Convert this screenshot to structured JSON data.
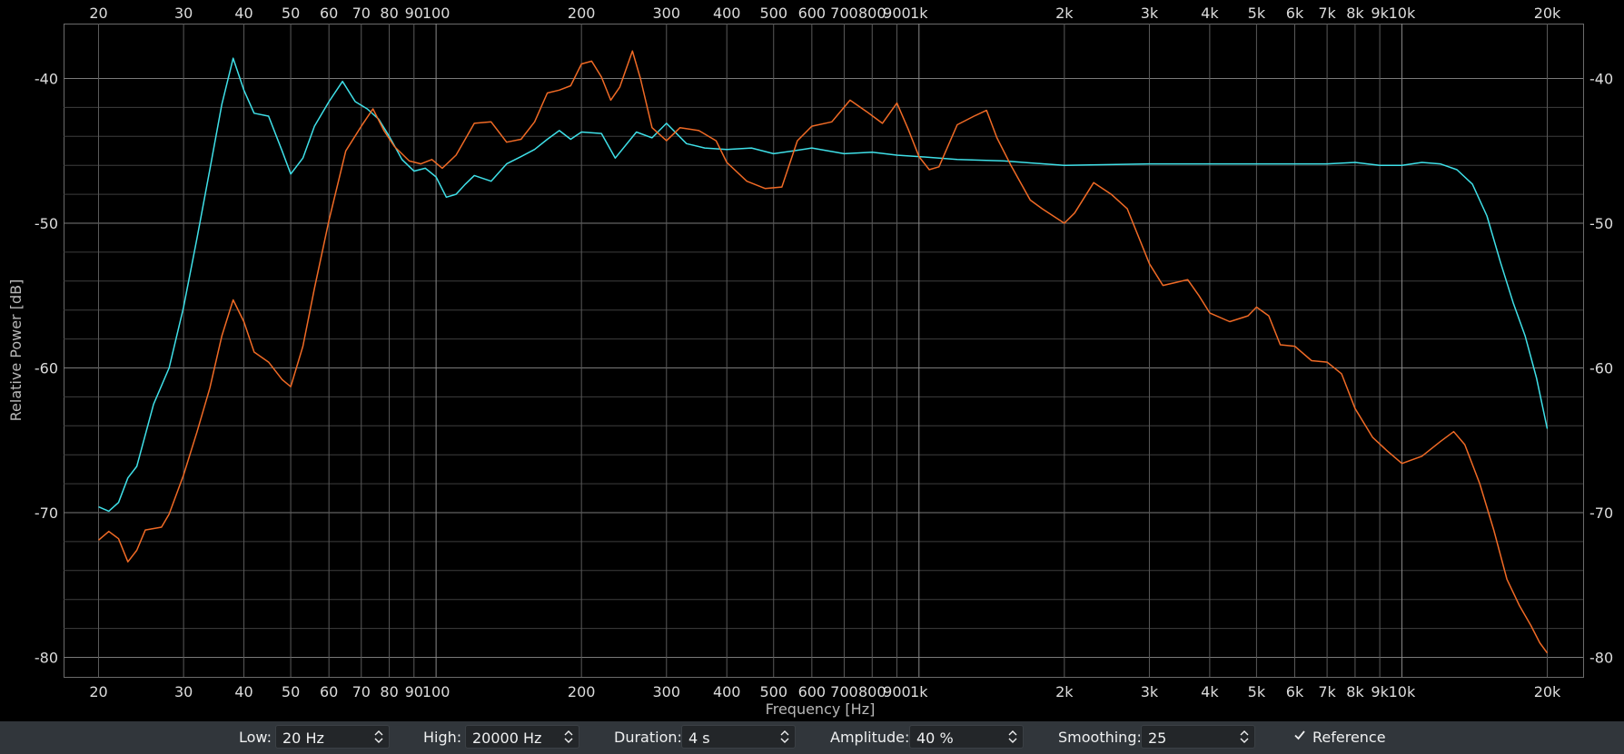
{
  "chart_data": {
    "type": "line",
    "xlabel": "Frequency [Hz]",
    "ylabel": "Relative Power [dB]",
    "x_scale": "log",
    "xlim": [
      20,
      20000
    ],
    "ylim": [
      -80,
      -40
    ],
    "grid": true,
    "x_ticks": [
      {
        "v": 20,
        "label": "20"
      },
      {
        "v": 30,
        "label": "30"
      },
      {
        "v": 40,
        "label": "40"
      },
      {
        "v": 50,
        "label": "50"
      },
      {
        "v": 60,
        "label": "60"
      },
      {
        "v": 70,
        "label": "70"
      },
      {
        "v": 80,
        "label": "80"
      },
      {
        "v": 90,
        "label": "90"
      },
      {
        "v": 100,
        "label": "100"
      },
      {
        "v": 200,
        "label": "200"
      },
      {
        "v": 300,
        "label": "300"
      },
      {
        "v": 400,
        "label": "400"
      },
      {
        "v": 500,
        "label": "500"
      },
      {
        "v": 600,
        "label": "600"
      },
      {
        "v": 700,
        "label": "700"
      },
      {
        "v": 800,
        "label": "800"
      },
      {
        "v": 900,
        "label": "900"
      },
      {
        "v": 1000,
        "label": "1k"
      },
      {
        "v": 2000,
        "label": "2k"
      },
      {
        "v": 3000,
        "label": "3k"
      },
      {
        "v": 4000,
        "label": "4k"
      },
      {
        "v": 5000,
        "label": "5k"
      },
      {
        "v": 6000,
        "label": "6k"
      },
      {
        "v": 7000,
        "label": "7k"
      },
      {
        "v": 8000,
        "label": "8k"
      },
      {
        "v": 9000,
        "label": "9k"
      },
      {
        "v": 10000,
        "label": "10k"
      },
      {
        "v": 20000,
        "label": "20k"
      }
    ],
    "y_ticks": [
      {
        "v": -40,
        "label": "-40"
      },
      {
        "v": -50,
        "label": "-50"
      },
      {
        "v": -60,
        "label": "-60"
      },
      {
        "v": -70,
        "label": "-70"
      },
      {
        "v": -80,
        "label": "-80"
      }
    ],
    "series": [
      {
        "color": "#3fe0e8",
        "points": [
          [
            20,
            -69.6
          ],
          [
            21,
            -69.9
          ],
          [
            22,
            -69.3
          ],
          [
            23,
            -67.6
          ],
          [
            24,
            -66.8
          ],
          [
            26,
            -62.5
          ],
          [
            28,
            -60.0
          ],
          [
            30,
            -55.8
          ],
          [
            32,
            -51.0
          ],
          [
            34,
            -46.3
          ],
          [
            36,
            -41.8
          ],
          [
            38,
            -38.6
          ],
          [
            40,
            -40.8
          ],
          [
            42,
            -42.4
          ],
          [
            45,
            -42.6
          ],
          [
            48,
            -45.0
          ],
          [
            50,
            -46.6
          ],
          [
            53,
            -45.5
          ],
          [
            56,
            -43.3
          ],
          [
            60,
            -41.6
          ],
          [
            64,
            -40.2
          ],
          [
            68,
            -41.6
          ],
          [
            72,
            -42.1
          ],
          [
            76,
            -42.8
          ],
          [
            80,
            -44.0
          ],
          [
            85,
            -45.6
          ],
          [
            90,
            -46.4
          ],
          [
            95,
            -46.2
          ],
          [
            100,
            -46.8
          ],
          [
            105,
            -48.2
          ],
          [
            110,
            -48.0
          ],
          [
            115,
            -47.3
          ],
          [
            120,
            -46.7
          ],
          [
            130,
            -47.1
          ],
          [
            140,
            -45.9
          ],
          [
            150,
            -45.4
          ],
          [
            160,
            -44.9
          ],
          [
            170,
            -44.2
          ],
          [
            180,
            -43.6
          ],
          [
            190,
            -44.2
          ],
          [
            200,
            -43.7
          ],
          [
            220,
            -43.8
          ],
          [
            235,
            -45.5
          ],
          [
            260,
            -43.7
          ],
          [
            280,
            -44.1
          ],
          [
            300,
            -43.1
          ],
          [
            330,
            -44.5
          ],
          [
            360,
            -44.8
          ],
          [
            400,
            -44.9
          ],
          [
            450,
            -44.8
          ],
          [
            500,
            -45.2
          ],
          [
            550,
            -45.0
          ],
          [
            600,
            -44.8
          ],
          [
            700,
            -45.2
          ],
          [
            800,
            -45.1
          ],
          [
            900,
            -45.3
          ],
          [
            1000,
            -45.4
          ],
          [
            1200,
            -45.6
          ],
          [
            1500,
            -45.7
          ],
          [
            2000,
            -46.0
          ],
          [
            3000,
            -45.9
          ],
          [
            4000,
            -45.9
          ],
          [
            5000,
            -45.9
          ],
          [
            6000,
            -45.9
          ],
          [
            7000,
            -45.9
          ],
          [
            8000,
            -45.8
          ],
          [
            9000,
            -46.0
          ],
          [
            10000,
            -46.0
          ],
          [
            11000,
            -45.8
          ],
          [
            12000,
            -45.9
          ],
          [
            13000,
            -46.3
          ],
          [
            14000,
            -47.3
          ],
          [
            15000,
            -49.5
          ],
          [
            16000,
            -52.7
          ],
          [
            17000,
            -55.5
          ],
          [
            18000,
            -57.8
          ],
          [
            19000,
            -60.7
          ],
          [
            20000,
            -64.2
          ]
        ]
      },
      {
        "color": "#f06a25",
        "points": [
          [
            20,
            -71.9
          ],
          [
            21,
            -71.3
          ],
          [
            22,
            -71.8
          ],
          [
            23,
            -73.4
          ],
          [
            24,
            -72.6
          ],
          [
            25,
            -71.2
          ],
          [
            27,
            -71.0
          ],
          [
            28,
            -70.1
          ],
          [
            30,
            -67.4
          ],
          [
            32,
            -64.4
          ],
          [
            34,
            -61.4
          ],
          [
            36,
            -57.8
          ],
          [
            38,
            -55.3
          ],
          [
            40,
            -56.8
          ],
          [
            42,
            -58.9
          ],
          [
            45,
            -59.6
          ],
          [
            48,
            -60.8
          ],
          [
            50,
            -61.3
          ],
          [
            53,
            -58.5
          ],
          [
            56,
            -54.5
          ],
          [
            60,
            -49.8
          ],
          [
            65,
            -45.0
          ],
          [
            70,
            -43.3
          ],
          [
            74,
            -42.1
          ],
          [
            78,
            -43.6
          ],
          [
            82,
            -44.7
          ],
          [
            88,
            -45.7
          ],
          [
            93,
            -45.9
          ],
          [
            98,
            -45.6
          ],
          [
            103,
            -46.2
          ],
          [
            110,
            -45.3
          ],
          [
            120,
            -43.1
          ],
          [
            130,
            -43.0
          ],
          [
            140,
            -44.4
          ],
          [
            150,
            -44.2
          ],
          [
            160,
            -43.0
          ],
          [
            170,
            -41.0
          ],
          [
            180,
            -40.8
          ],
          [
            190,
            -40.5
          ],
          [
            200,
            -39.0
          ],
          [
            210,
            -38.8
          ],
          [
            220,
            -39.9
          ],
          [
            230,
            -41.5
          ],
          [
            240,
            -40.6
          ],
          [
            255,
            -38.1
          ],
          [
            265,
            -40.0
          ],
          [
            280,
            -43.4
          ],
          [
            300,
            -44.3
          ],
          [
            320,
            -43.4
          ],
          [
            350,
            -43.6
          ],
          [
            380,
            -44.3
          ],
          [
            400,
            -45.8
          ],
          [
            440,
            -47.1
          ],
          [
            480,
            -47.6
          ],
          [
            520,
            -47.5
          ],
          [
            560,
            -44.3
          ],
          [
            600,
            -43.3
          ],
          [
            660,
            -43.0
          ],
          [
            720,
            -41.5
          ],
          [
            780,
            -42.3
          ],
          [
            840,
            -43.1
          ],
          [
            900,
            -41.7
          ],
          [
            950,
            -43.5
          ],
          [
            1000,
            -45.4
          ],
          [
            1050,
            -46.3
          ],
          [
            1100,
            -46.1
          ],
          [
            1200,
            -43.2
          ],
          [
            1300,
            -42.6
          ],
          [
            1380,
            -42.2
          ],
          [
            1450,
            -44.1
          ],
          [
            1550,
            -46.0
          ],
          [
            1700,
            -48.4
          ],
          [
            1800,
            -49.0
          ],
          [
            2000,
            -50.0
          ],
          [
            2100,
            -49.3
          ],
          [
            2300,
            -47.2
          ],
          [
            2500,
            -48.0
          ],
          [
            2700,
            -49.0
          ],
          [
            3000,
            -52.8
          ],
          [
            3200,
            -54.3
          ],
          [
            3400,
            -54.1
          ],
          [
            3600,
            -53.9
          ],
          [
            3800,
            -55.0
          ],
          [
            4000,
            -56.2
          ],
          [
            4400,
            -56.8
          ],
          [
            4800,
            -56.4
          ],
          [
            5000,
            -55.8
          ],
          [
            5300,
            -56.4
          ],
          [
            5600,
            -58.4
          ],
          [
            6000,
            -58.5
          ],
          [
            6500,
            -59.5
          ],
          [
            7000,
            -59.6
          ],
          [
            7500,
            -60.4
          ],
          [
            8000,
            -62.8
          ],
          [
            8700,
            -64.8
          ],
          [
            9300,
            -65.7
          ],
          [
            10000,
            -66.6
          ],
          [
            11000,
            -66.1
          ],
          [
            12000,
            -65.1
          ],
          [
            12800,
            -64.4
          ],
          [
            13500,
            -65.3
          ],
          [
            14500,
            -68.0
          ],
          [
            15500,
            -71.2
          ],
          [
            16500,
            -74.6
          ],
          [
            17500,
            -76.4
          ],
          [
            18500,
            -77.8
          ],
          [
            19300,
            -79.0
          ],
          [
            20000,
            -79.7
          ]
        ]
      }
    ]
  },
  "toolbar": {
    "low_label": "Low:",
    "low_value": "20 Hz",
    "high_label": "High:",
    "high_value": "20000 Hz",
    "duration_label": "Duration:",
    "duration_value": "4 s",
    "amplitude_label": "Amplitude:",
    "amplitude_value": "40 %",
    "smoothing_label": "Smoothing:",
    "smoothing_value": "25",
    "reference_label": "Reference",
    "reference_checked": true
  }
}
